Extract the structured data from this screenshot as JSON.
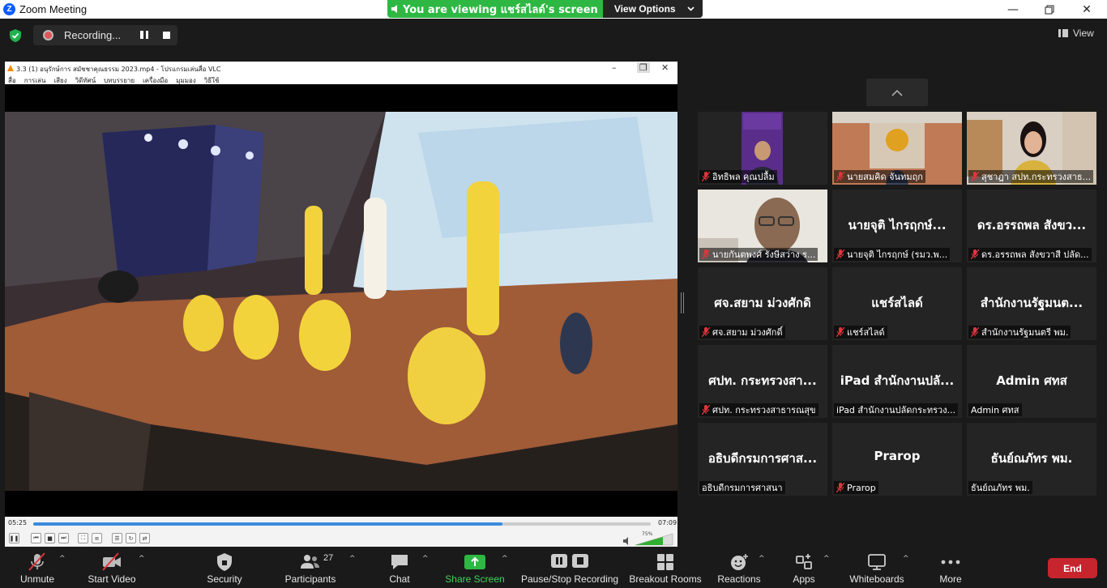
{
  "window": {
    "title": "Zoom Meeting",
    "logo_letter": "Z"
  },
  "share_banner": {
    "message": "You are viewing แชร์สไลด์'s screen",
    "options_label": "View Options"
  },
  "recording": {
    "label": "Recording..."
  },
  "view_button": {
    "label": "View"
  },
  "vlc": {
    "title": "3.3 (1) อนุรักษ์การ สมัชชาคุณธรรม 2023.mp4 - โปรแกรมเล่นสื่อ VLC",
    "menu": [
      "สื่อ",
      "การเล่น",
      "เสียง",
      "วิดีทัศน์",
      "บทบรรยาย",
      "เครื่องมือ",
      "มุมมอง",
      "วิธีใช้"
    ],
    "time_elapsed": "05:25",
    "time_total": "07:09",
    "progress": 0.76,
    "volume": "75%"
  },
  "participants": [
    {
      "caption": "อิทธิพล คุณปลื้ม",
      "muted": true,
      "video": "ministry-speaker"
    },
    {
      "caption": "นายสมคิด จันทมฤก",
      "muted": true,
      "video": "ministry-office"
    },
    {
      "caption": "สุชาฎา สปท.กระทรวงสาธ...",
      "muted": true,
      "video": "woman-office"
    },
    {
      "caption": "นายกันตพงศ์ รังษีสว่าง ร...",
      "muted": true,
      "video": "man-glasses"
    },
    {
      "big": "นายจุติ ไกรฤกษ์...",
      "caption": "นายจุติ ไกรฤกษ์ (รมว.พ...",
      "muted": true
    },
    {
      "big": "ดร.อรรถพล สังขว...",
      "caption": "ดร.อรรถพล สังขวาสี ปลัด...",
      "muted": true
    },
    {
      "big": "ศจ.สยาม ม่วงศักดิ",
      "caption": "ศจ.สยาม ม่วงศักดิ์",
      "muted": true
    },
    {
      "big": "แชร์สไลด์",
      "caption": "แชร์สไลด์",
      "muted": true
    },
    {
      "big": "สำนักงานรัฐมนต...",
      "caption": "สำนักงานรัฐมนตรี พม.",
      "muted": true
    },
    {
      "big": "ศปท. กระทรวงสา...",
      "caption": "ศปท. กระทรวงสาธารณสุข",
      "muted": true
    },
    {
      "big": "iPad สำนักงานปลั...",
      "caption": "iPad สำนักงานปลัดกระทรวง...",
      "muted": false
    },
    {
      "big": "Admin ศทส",
      "caption": "Admin ศทส",
      "muted": false
    },
    {
      "big": "อธิบดีกรมการศาส...",
      "caption": "อธิบดีกรมการศาสนา",
      "muted": false
    },
    {
      "big": "Prarop",
      "caption": "Prarop",
      "muted": true
    },
    {
      "big": "ธันย์ณภัทร พม.",
      "caption": "ธันย์ณภัทร พม.",
      "muted": false
    }
  ],
  "toolbar": {
    "unmute": "Unmute",
    "start_video": "Start Video",
    "security": "Security",
    "participants": "Participants",
    "participants_count": "27",
    "chat": "Chat",
    "share_screen": "Share Screen",
    "pause_stop_recording": "Pause/Stop Recording",
    "breakout_rooms": "Breakout Rooms",
    "reactions": "Reactions",
    "apps": "Apps",
    "whiteboards": "Whiteboards",
    "more": "More",
    "end": "End"
  },
  "colors": {
    "share_green": "#2eb843",
    "end_red": "#c7252e",
    "mute_red": "#e0353d",
    "vlc_progress": "#3a8ddc"
  }
}
